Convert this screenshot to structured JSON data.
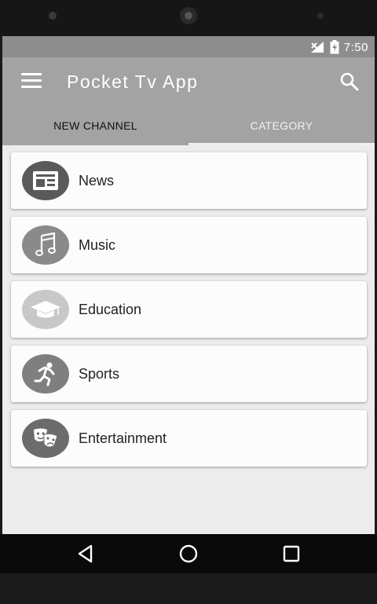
{
  "status": {
    "time": "7:50"
  },
  "appbar": {
    "title": "Pocket Tv App"
  },
  "tabs": [
    {
      "label": "NEW CHANNEL",
      "active": true
    },
    {
      "label": "CATEGORY",
      "active": false
    }
  ],
  "categories": [
    {
      "label": "News",
      "icon": "newspaper-icon",
      "color": "#5a5a5a"
    },
    {
      "label": "Music",
      "icon": "music-note-icon",
      "color": "#8a8a8a"
    },
    {
      "label": "Education",
      "icon": "graduation-cap-icon",
      "color": "#c8c8c8"
    },
    {
      "label": "Sports",
      "icon": "runner-icon",
      "color": "#7f7f7f"
    },
    {
      "label": "Entertainment",
      "icon": "theater-masks-icon",
      "color": "#6c6c6c"
    }
  ],
  "colors": {
    "statusbar": "#8d8d8d",
    "appbar": "#a3a3a3",
    "background": "#ececec",
    "navbar": "#0a0a0a"
  }
}
